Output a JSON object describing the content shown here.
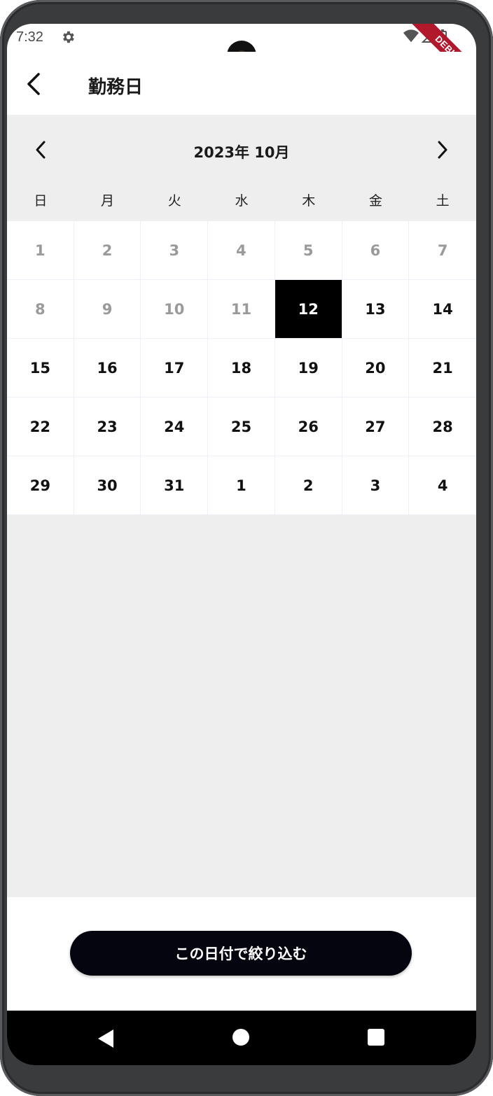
{
  "status_bar": {
    "time": "7:32",
    "icons": [
      "gear-icon",
      "wifi-icon",
      "signal-icon",
      "battery-icon"
    ],
    "debug_banner": "DEBUG"
  },
  "app_bar": {
    "title": "勤務日",
    "back_icon": "chevron-left-icon"
  },
  "calendar": {
    "month_label": "2023年 10月",
    "weekdays": [
      "日",
      "月",
      "火",
      "水",
      "木",
      "金",
      "土"
    ],
    "days": [
      {
        "label": "1",
        "muted": true
      },
      {
        "label": "2",
        "muted": true
      },
      {
        "label": "3",
        "muted": true
      },
      {
        "label": "4",
        "muted": true
      },
      {
        "label": "5",
        "muted": true
      },
      {
        "label": "6",
        "muted": true
      },
      {
        "label": "7",
        "muted": true
      },
      {
        "label": "8",
        "muted": true
      },
      {
        "label": "9",
        "muted": true
      },
      {
        "label": "10",
        "muted": true
      },
      {
        "label": "11",
        "muted": true
      },
      {
        "label": "12",
        "selected": true
      },
      {
        "label": "13"
      },
      {
        "label": "14"
      },
      {
        "label": "15"
      },
      {
        "label": "16"
      },
      {
        "label": "17"
      },
      {
        "label": "18"
      },
      {
        "label": "19"
      },
      {
        "label": "20"
      },
      {
        "label": "21"
      },
      {
        "label": "22"
      },
      {
        "label": "23"
      },
      {
        "label": "24"
      },
      {
        "label": "25"
      },
      {
        "label": "26"
      },
      {
        "label": "27"
      },
      {
        "label": "28"
      },
      {
        "label": "29"
      },
      {
        "label": "30"
      },
      {
        "label": "31"
      },
      {
        "label": "1"
      },
      {
        "label": "2"
      },
      {
        "label": "3"
      },
      {
        "label": "4"
      }
    ]
  },
  "footer": {
    "filter_button": "この日付で絞り込む"
  },
  "colors": {
    "selected_bg": "#000000",
    "muted_text": "#9a9a9a",
    "calendar_bg": "#eeeeee",
    "debug_banner": "#b2182b"
  }
}
